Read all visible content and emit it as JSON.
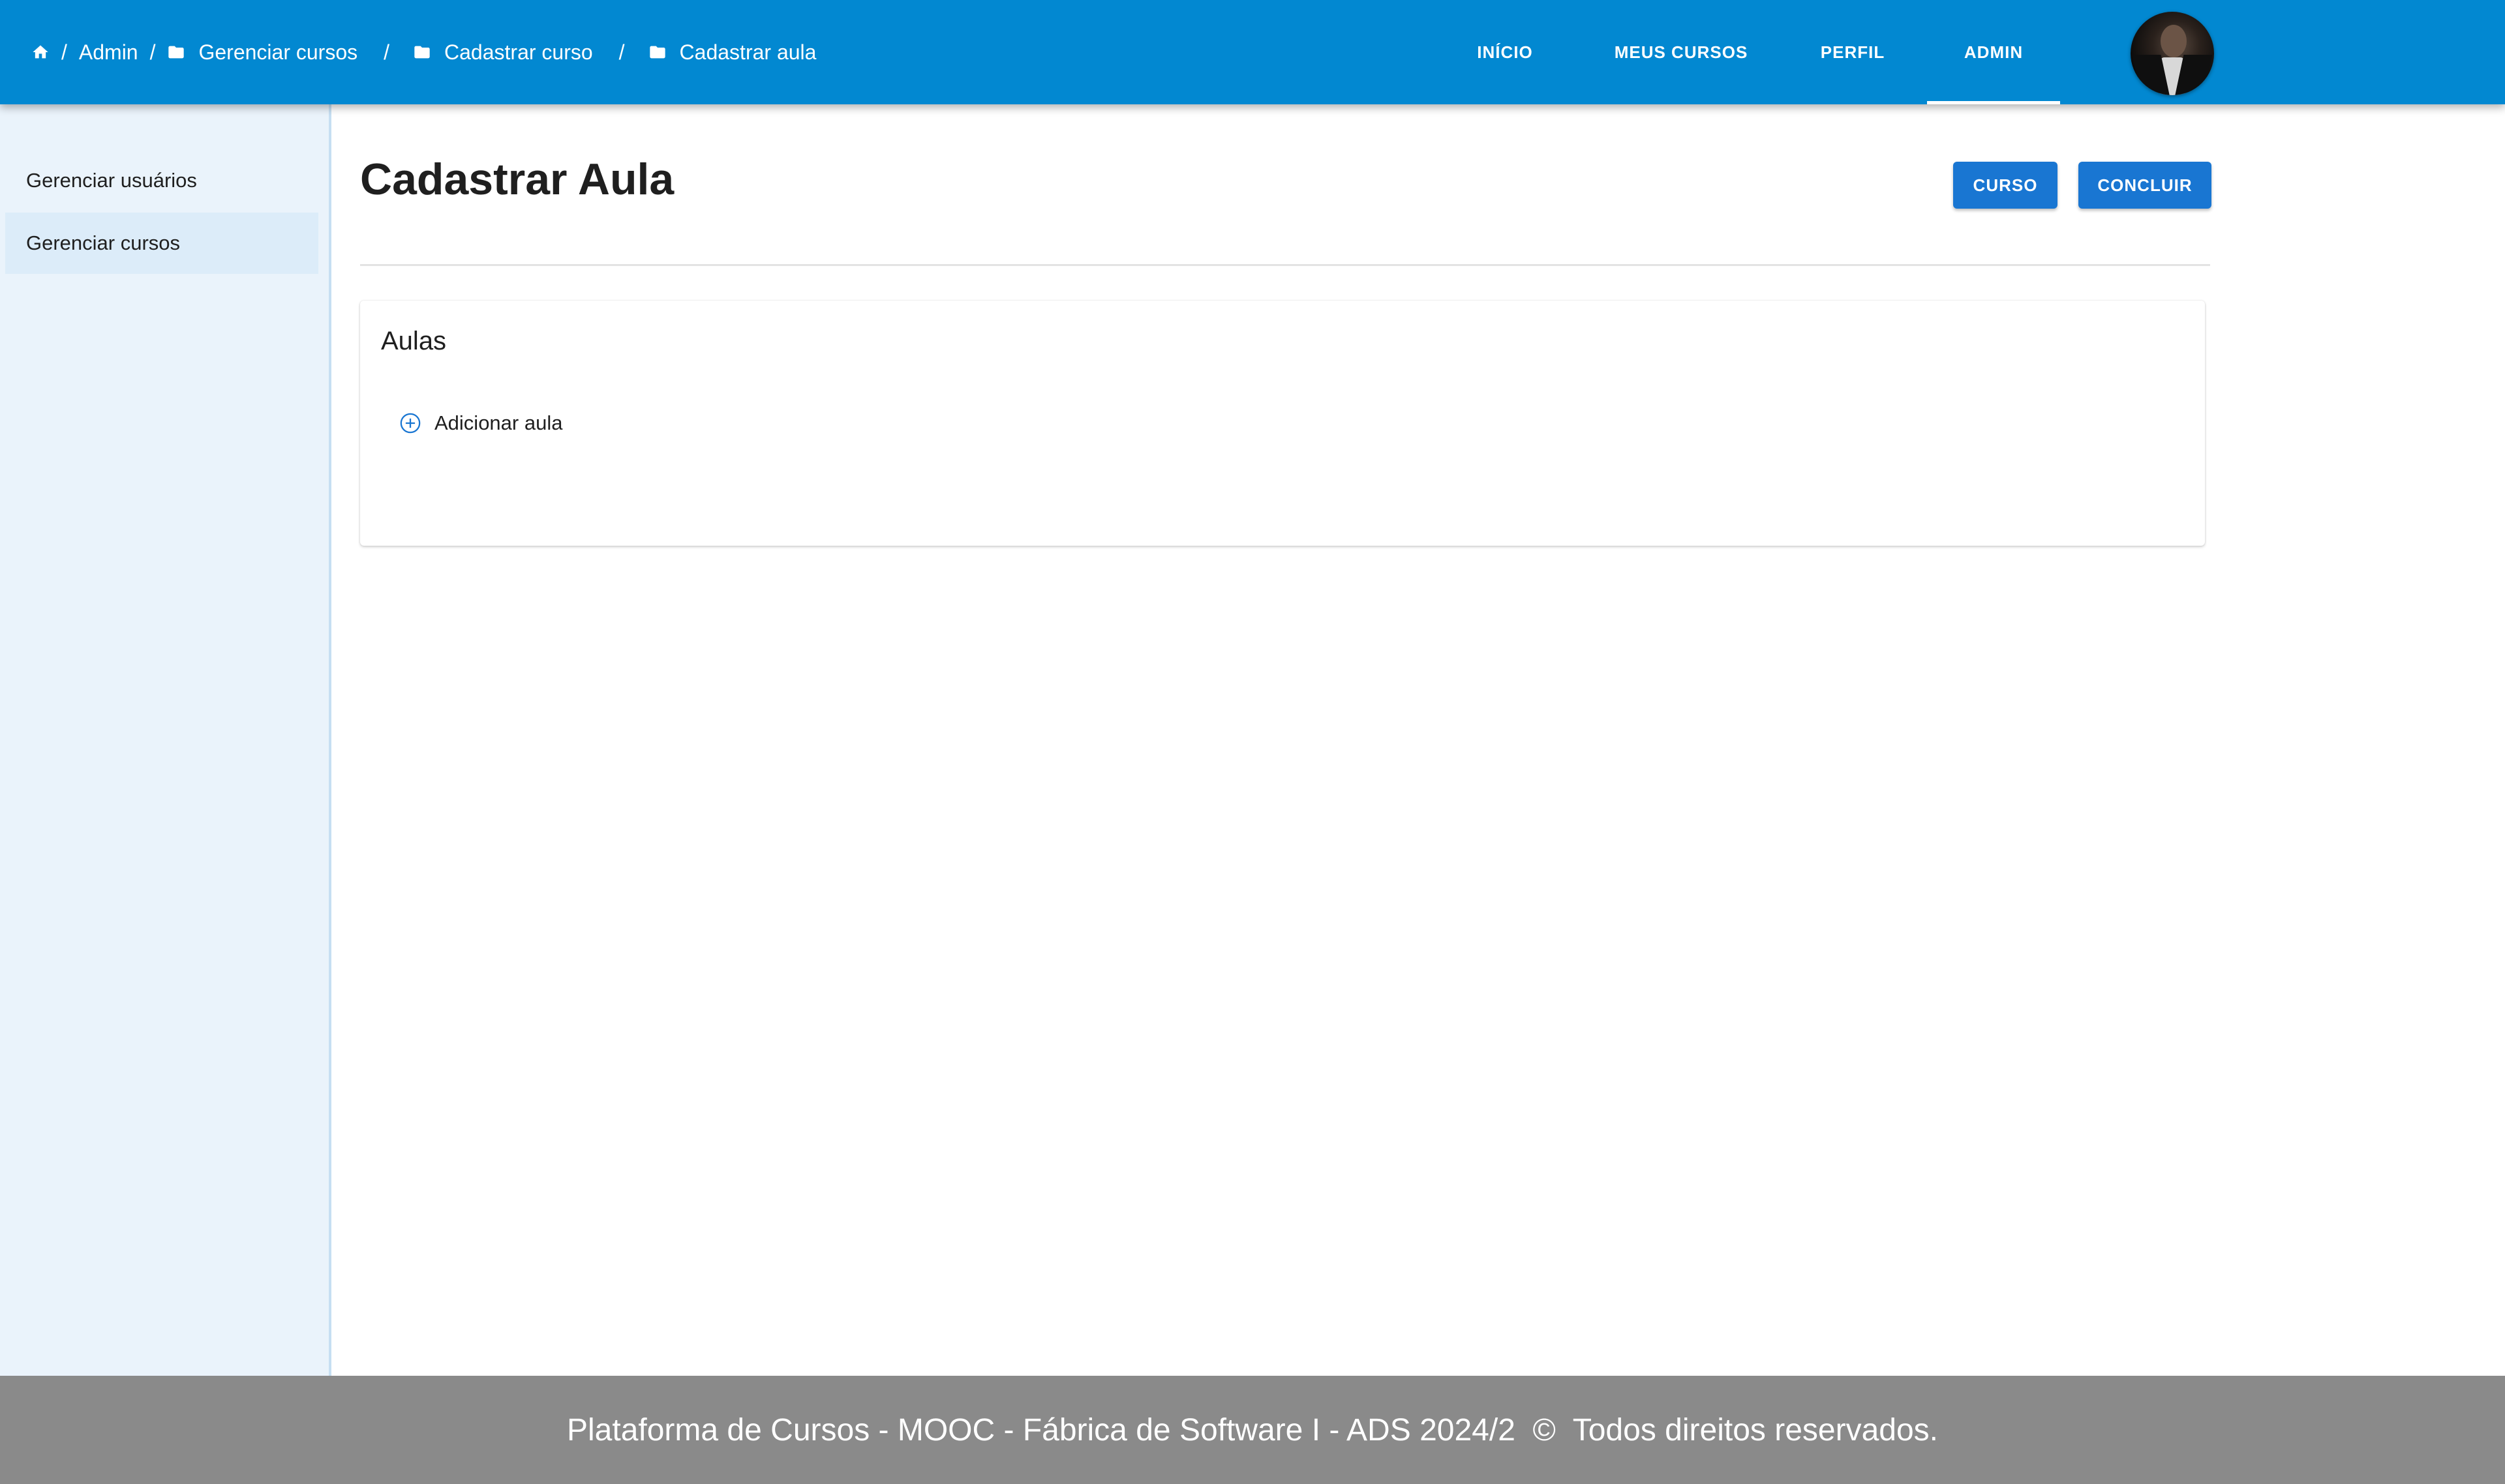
{
  "breadcrumb": {
    "items": [
      {
        "label": "Admin"
      },
      {
        "label": "Gerenciar cursos"
      },
      {
        "label": "Cadastrar curso"
      },
      {
        "label": "Cadastrar aula"
      }
    ],
    "separator": "/"
  },
  "nav": {
    "items": [
      {
        "label": "INÍCIO"
      },
      {
        "label": "MEUS CURSOS"
      },
      {
        "label": "PERFIL"
      },
      {
        "label": "ADMIN"
      }
    ],
    "active": "ADMIN"
  },
  "sidebar": {
    "items": [
      {
        "label": "Gerenciar usuários"
      },
      {
        "label": "Gerenciar cursos"
      }
    ],
    "active": "Gerenciar cursos"
  },
  "main": {
    "title": "Cadastrar Aula",
    "buttons": {
      "curso": "CURSO",
      "concluir": "CONCLUIR"
    },
    "card": {
      "title": "Aulas",
      "add_label": "Adicionar aula"
    }
  },
  "footer": {
    "text": "Plataforma de Cursos - MOOC - Fábrica de Software I - ADS 2024/2  ©  Todos direitos reservados."
  },
  "colors": {
    "appbar": "#0288d1",
    "button": "#1976d2",
    "sidebar": "#eaf3fb",
    "footer": "#8a8a8a"
  },
  "icons": [
    "home-icon",
    "folder-icon",
    "add-circle-icon"
  ]
}
